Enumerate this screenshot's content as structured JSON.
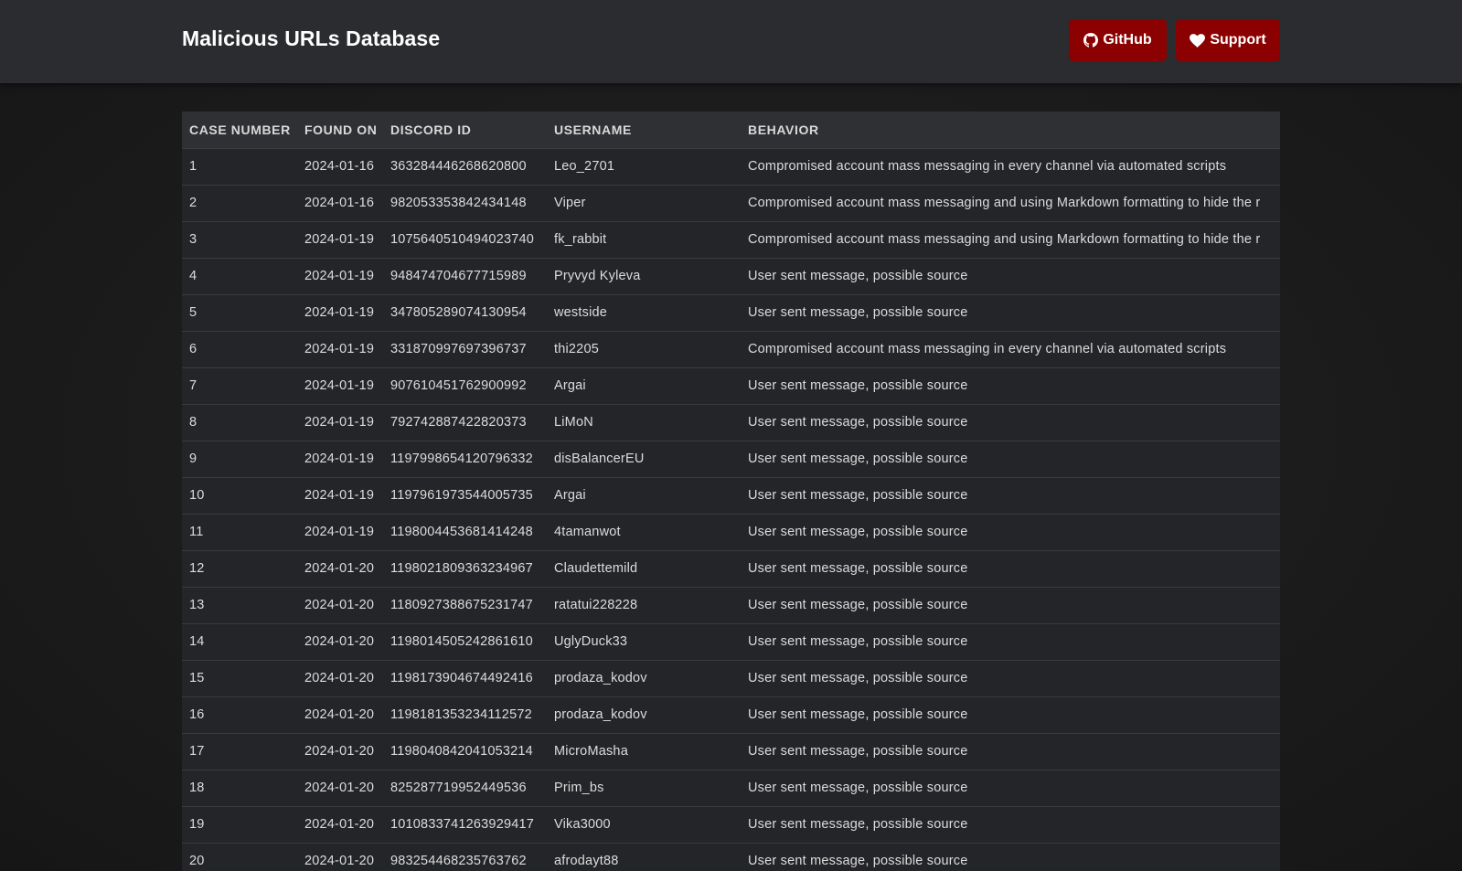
{
  "header": {
    "title": "Malicious URLs Database",
    "buttons": [
      {
        "label": "GitHub",
        "icon": "github-icon"
      },
      {
        "label": "Support",
        "icon": "heart-icon"
      }
    ]
  },
  "colors": {
    "header_bg": "#2b2c2f",
    "button_bg": "#8b0000",
    "page_bg": "#1c1c1c"
  },
  "table": {
    "columns": [
      "CASE NUMBER",
      "FOUND ON",
      "DISCORD ID",
      "USERNAME",
      "BEHAVIOR"
    ],
    "rows": [
      [
        "1",
        "2024-01-16",
        "363284446268620800",
        "Leo_2701",
        "Compromised account mass messaging in every channel via automated scripts"
      ],
      [
        "2",
        "2024-01-16",
        "982053353842434148",
        "Viper",
        "Compromised account mass messaging and using Markdown formatting to hide the r"
      ],
      [
        "3",
        "2024-01-19",
        "1075640510494023740",
        "fk_rabbit",
        "Compromised account mass messaging and using Markdown formatting to hide the r"
      ],
      [
        "4",
        "2024-01-19",
        "948474704677715989",
        "Pryvyd Kyleva",
        "User sent message, possible source"
      ],
      [
        "5",
        "2024-01-19",
        "347805289074130954",
        "westside",
        "User sent message, possible source"
      ],
      [
        "6",
        "2024-01-19",
        "331870997697396737",
        "thi2205",
        "Compromised account mass messaging in every channel via automated scripts"
      ],
      [
        "7",
        "2024-01-19",
        "907610451762900992",
        "Argai",
        "User sent message, possible source"
      ],
      [
        "8",
        "2024-01-19",
        "792742887422820373",
        "LiMoN",
        "User sent message, possible source"
      ],
      [
        "9",
        "2024-01-19",
        "1197998654120796332",
        "disBalancerEU",
        "User sent message, possible source"
      ],
      [
        "10",
        "2024-01-19",
        "1197961973544005735",
        "Argai",
        "User sent message, possible source"
      ],
      [
        "11",
        "2024-01-19",
        "1198004453681414248",
        "4tamanwot",
        "User sent message, possible source"
      ],
      [
        "12",
        "2024-01-20",
        "1198021809363234967",
        "Claudettemild",
        "User sent message, possible source"
      ],
      [
        "13",
        "2024-01-20",
        "1180927388675231747",
        "ratatui228228",
        "User sent message, possible source"
      ],
      [
        "14",
        "2024-01-20",
        "1198014505242861610",
        "UglyDuck33",
        "User sent message, possible source"
      ],
      [
        "15",
        "2024-01-20",
        "1198173904674492416",
        "prodaza_kodov",
        "User sent message, possible source"
      ],
      [
        "16",
        "2024-01-20",
        "1198181353234112572",
        "prodaza_kodov",
        "User sent message, possible source"
      ],
      [
        "17",
        "2024-01-20",
        "1198040842041053214",
        "MicroMasha",
        "User sent message, possible source"
      ],
      [
        "18",
        "2024-01-20",
        "825287719952449536",
        "Prim_bs",
        "User sent message, possible source"
      ],
      [
        "19",
        "2024-01-20",
        "1010833741263929417",
        "Vika3000",
        "User sent message, possible source"
      ],
      [
        "20",
        "2024-01-20",
        "983254468235763762",
        "afrodayt88",
        "User sent message, possible source"
      ]
    ]
  }
}
